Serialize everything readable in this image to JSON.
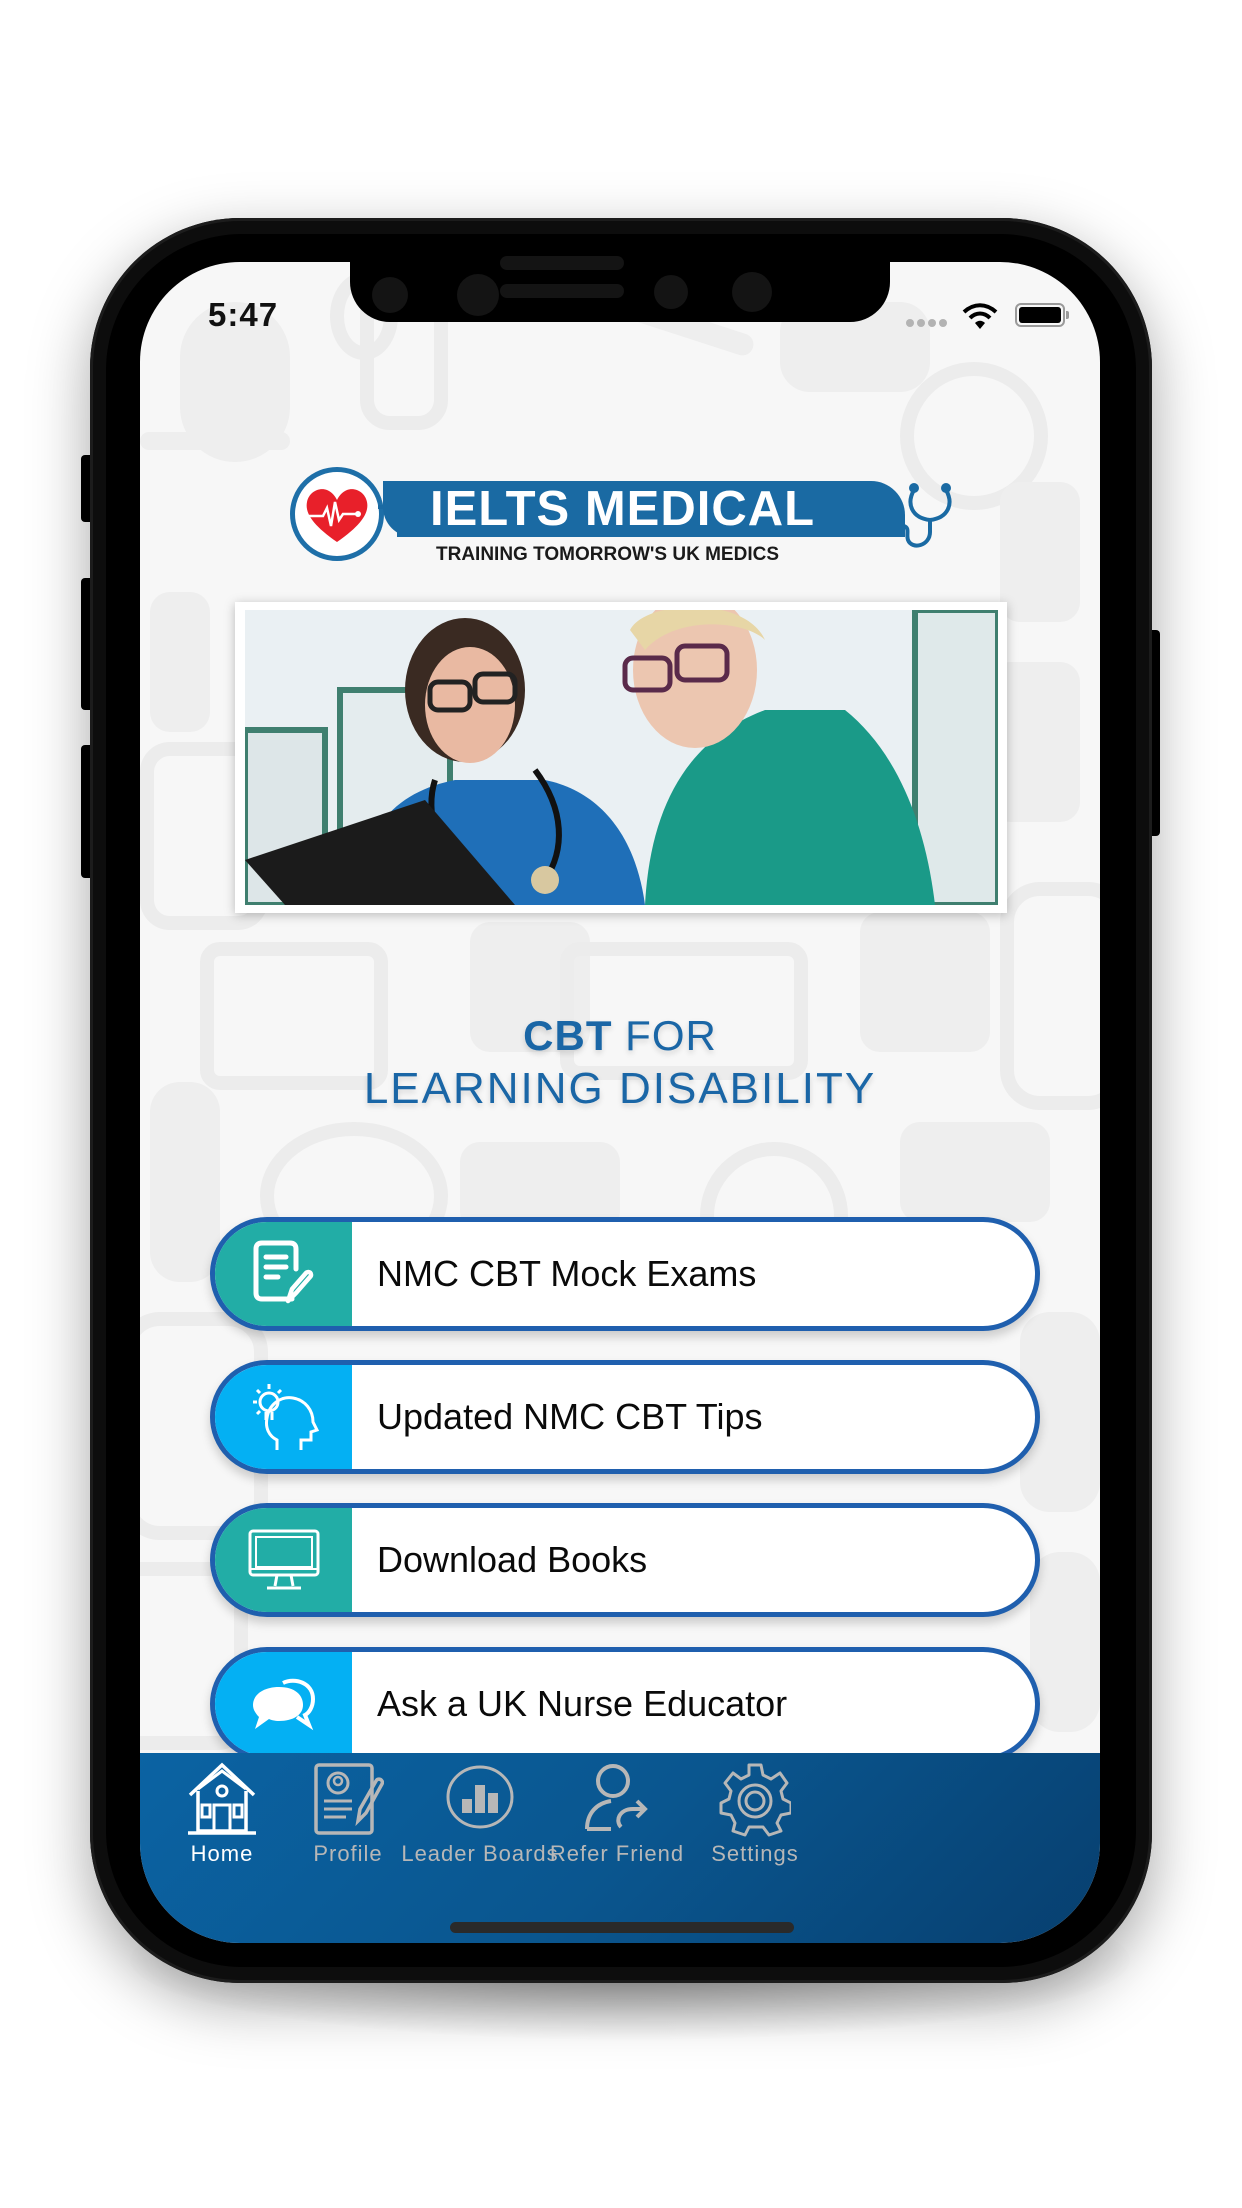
{
  "status_bar": {
    "time": "5:47",
    "wifi_icon": "wifi-icon",
    "battery_icon": "battery-icon",
    "signal_icon": "signal-dots-icon"
  },
  "logo": {
    "title": "IELTS MEDICAL",
    "tagline": "TRAINING TOMORROW'S UK MEDICS",
    "heart_icon": "heart-pulse-icon",
    "stethoscope_icon": "stethoscope-icon",
    "colors": {
      "blue": "#1a6aa3",
      "red": "#e8202a"
    }
  },
  "hero_image": {
    "alt": "Two nurses in scrubs looking at a clipboard"
  },
  "headline": {
    "bold": "CBT",
    "rest_line1": " FOR",
    "line2": "LEARNING DISABILITY",
    "color": "#1a66a6"
  },
  "menu": [
    {
      "label": "NMC CBT Mock Exams",
      "icon": "document-edit-icon",
      "color": "#22ada6"
    },
    {
      "label": "Updated NMC CBT Tips",
      "icon": "idea-head-icon",
      "color": "#04b0f3"
    },
    {
      "label": "Download Books",
      "icon": "monitor-icon",
      "color": "#22ada6"
    },
    {
      "label": "Ask a UK Nurse Educator",
      "icon": "chat-bubbles-icon",
      "color": "#04b0f3"
    }
  ],
  "menu_border_color": "#1f5fae",
  "tabbar": {
    "active_index": 0,
    "items": [
      {
        "label": "Home",
        "icon": "home-icon"
      },
      {
        "label": "Profile",
        "icon": "profile-document-icon"
      },
      {
        "label": "Leader Boards",
        "icon": "leaderboard-icon"
      },
      {
        "label": "Refer Friend",
        "icon": "refer-friend-icon"
      },
      {
        "label": "Settings",
        "icon": "settings-gear-icon"
      }
    ],
    "active_color": "#ffffff",
    "inactive_color": "#b7b7b7",
    "background": "#0a5c9a"
  }
}
